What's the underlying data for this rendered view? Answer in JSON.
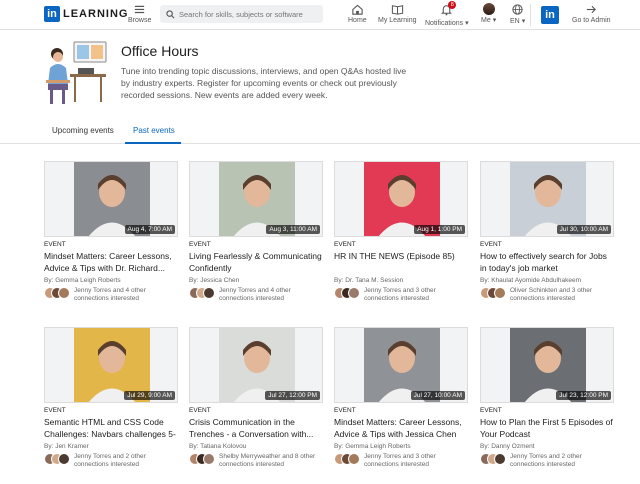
{
  "nav": {
    "brand": "LEARNING",
    "brand_logo": "in",
    "browse": "Browse",
    "search_placeholder": "Search for skills, subjects or software",
    "home": "Home",
    "my_learning": "My Learning",
    "notifications": "Notifications",
    "notif_count": "8",
    "me": "Me",
    "lang": "EN",
    "admin_logo": "in",
    "go_to_admin": "Go to Admin"
  },
  "header": {
    "title": "Office Hours",
    "description": "Tune into trending topic discussions, interviews, and open Q&As hosted live by industry experts. Register for upcoming events or check out previously recorded sessions. New events are added every week."
  },
  "tabs": [
    {
      "label": "Upcoming events",
      "active": false
    },
    {
      "label": "Past events",
      "active": true
    }
  ],
  "cards": [
    {
      "time": "Aug 4, 7:00 AM",
      "type": "EVENT",
      "title": "Mindset Matters: Career Lessons, Advice & Tips with Dr. Richard...",
      "author": "By: Gemma Leigh Roberts",
      "interest": "Jenny Torres and 4 other connections interested",
      "photo_bg": "#8a8d92"
    },
    {
      "time": "Aug 3, 11:00 AM",
      "type": "EVENT",
      "title": "Living Fearlessly & Communicating Confidently",
      "author": "By: Jessica Chen",
      "interest": "Jenny Torres and 4 other connections interested",
      "photo_bg": "#b9c3b4"
    },
    {
      "time": "Aug 1, 1:00 PM",
      "type": "EVENT",
      "title": "HR IN THE NEWS (Episode 85)",
      "author": "By: Dr. Tana M. Session",
      "interest": "Jenny Torres and 3 other connections interested",
      "photo_bg": "#e23a54"
    },
    {
      "time": "Jul 30, 10:00 AM",
      "type": "EVENT",
      "title": "How to effectively search for Jobs in today's job market",
      "author": "By: Khaulat Ayomide Abdulhakeem",
      "interest": "Oliver Schinkten and 3 other connections interested",
      "photo_bg": "#c9cfd6"
    },
    {
      "time": "Jul 29, 9:00 AM",
      "type": "EVENT",
      "title": "Semantic HTML and CSS Code Challenges: Navbars challenges 5-8",
      "author": "By: Jen Kramer",
      "interest": "Jenny Torres and 2 other connections interested",
      "photo_bg": "#e3b64a"
    },
    {
      "time": "Jul 27, 12:00 PM",
      "type": "EVENT",
      "title": "Crisis Communication in the Trenches - a Conversation with...",
      "author": "By: Tatiana Kolovou",
      "interest": "Shelby Merryweather and 8 other connections interested",
      "photo_bg": "#d9dcd8"
    },
    {
      "time": "Jul 27, 10:00 AM",
      "type": "EVENT",
      "title": "Mindset Matters: Career Lessons, Advice & Tips with Jessica Chen",
      "author": "By: Gemma Leigh Roberts",
      "interest": "Jenny Torres and 3 other connections interested",
      "photo_bg": "#8f9296"
    },
    {
      "time": "Jul 23, 12:00 PM",
      "type": "EVENT",
      "title": "How to Plan the First 5 Episodes of Your Podcast",
      "author": "By: Danny Ozment",
      "interest": "Jenny Torres and 2 other connections interested",
      "photo_bg": "#6b6f73"
    }
  ]
}
